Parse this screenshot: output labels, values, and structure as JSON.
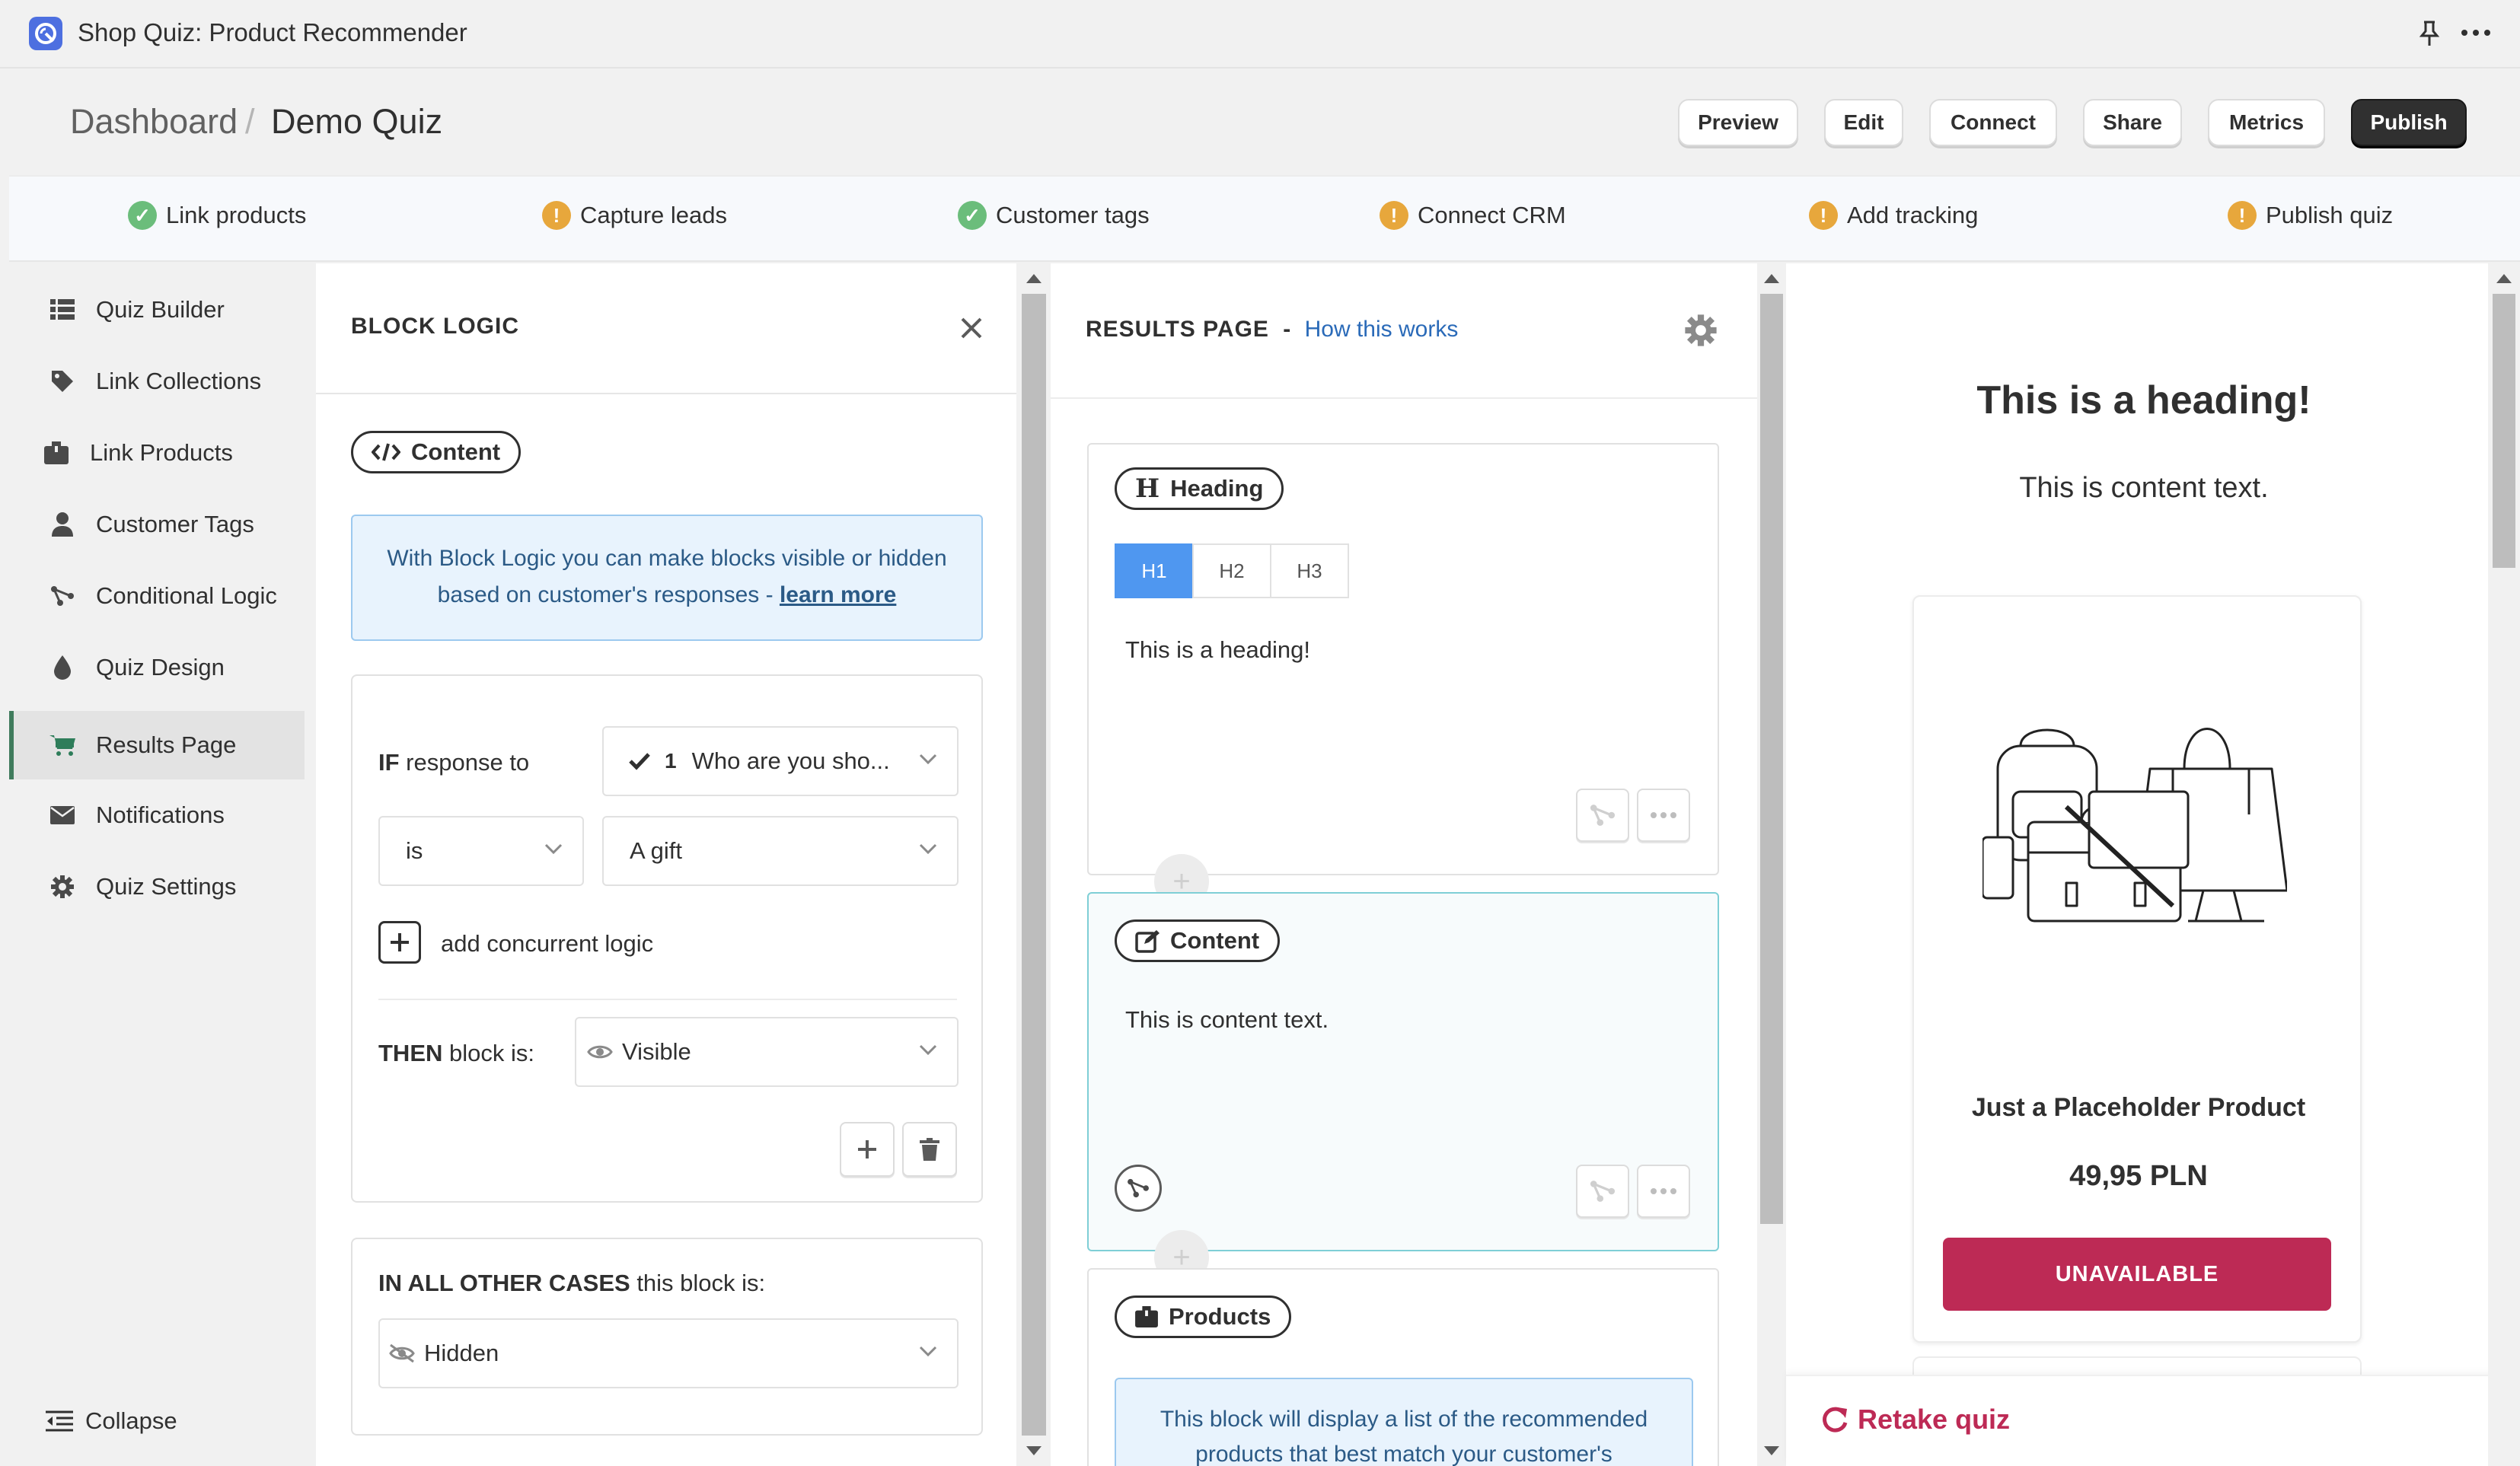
{
  "app": {
    "title": "Shop Quiz: Product Recommender"
  },
  "breadcrumb": {
    "root": "Dashboard",
    "separator": "/",
    "current": "Demo Quiz"
  },
  "header_buttons": {
    "preview": "Preview",
    "edit": "Edit",
    "connect": "Connect",
    "share": "Share",
    "metrics": "Metrics",
    "publish": "Publish"
  },
  "steps": [
    {
      "label": "Link products",
      "status": "done"
    },
    {
      "label": "Capture leads",
      "status": "warning"
    },
    {
      "label": "Customer tags",
      "status": "done"
    },
    {
      "label": "Connect CRM",
      "status": "warning"
    },
    {
      "label": "Add tracking",
      "status": "warning"
    },
    {
      "label": "Publish quiz",
      "status": "warning"
    }
  ],
  "sidebar": {
    "items": [
      {
        "label": "Quiz Builder",
        "icon": "list-icon"
      },
      {
        "label": "Link Collections",
        "icon": "tag-icon"
      },
      {
        "label": "Link Products",
        "icon": "box-icon"
      },
      {
        "label": "Customer Tags",
        "icon": "person-icon"
      },
      {
        "label": "Conditional Logic",
        "icon": "branch-icon"
      },
      {
        "label": "Quiz Design",
        "icon": "drop-icon"
      },
      {
        "label": "Results Page",
        "icon": "cart-icon",
        "active": true
      },
      {
        "label": "Notifications",
        "icon": "envelope-icon"
      },
      {
        "label": "Quiz Settings",
        "icon": "gear-icon"
      }
    ],
    "collapse": "Collapse"
  },
  "block_logic": {
    "title": "BLOCK LOGIC",
    "content_pill": "Content",
    "info_text": "With Block Logic you can make blocks visible or hidden based on customer's responses - ",
    "info_link": "learn more",
    "if_keyword": "IF",
    "if_rest": " response to",
    "question_number": "1",
    "question_value": "Who are you sho...",
    "operator_value": "is",
    "answer_value": "A gift",
    "add_concurrent": "add concurrent logic",
    "then_keyword": "THEN",
    "then_rest": " block is:",
    "then_value": "Visible",
    "else_keyword": "IN ALL OTHER CASES",
    "else_rest": " this block is:",
    "else_value": "Hidden"
  },
  "results": {
    "title": "RESULTS PAGE",
    "dash": "-",
    "how_link": "How this works",
    "heading_block": {
      "pill": "Heading",
      "tabs": [
        "H1",
        "H2",
        "H3"
      ],
      "active_tab": "H1",
      "text": "This is a heading!"
    },
    "content_block": {
      "pill": "Content",
      "text": "This is content text."
    },
    "products_block": {
      "pill": "Products",
      "info": "This block will display a list of the recommended products that best match your customer's"
    }
  },
  "preview": {
    "heading": "This is a heading!",
    "content": "This is content text.",
    "product_name": "Just a Placeholder Product",
    "price": "49,95 PLN",
    "button": "UNAVAILABLE",
    "retake": "Retake quiz"
  },
  "colors": {
    "accent_blue": "#4f97f0",
    "success": "#6bbd7b",
    "warning": "#e7a73c",
    "brand_red": "#bd2a55",
    "active_bar": "#3f7b5c"
  }
}
